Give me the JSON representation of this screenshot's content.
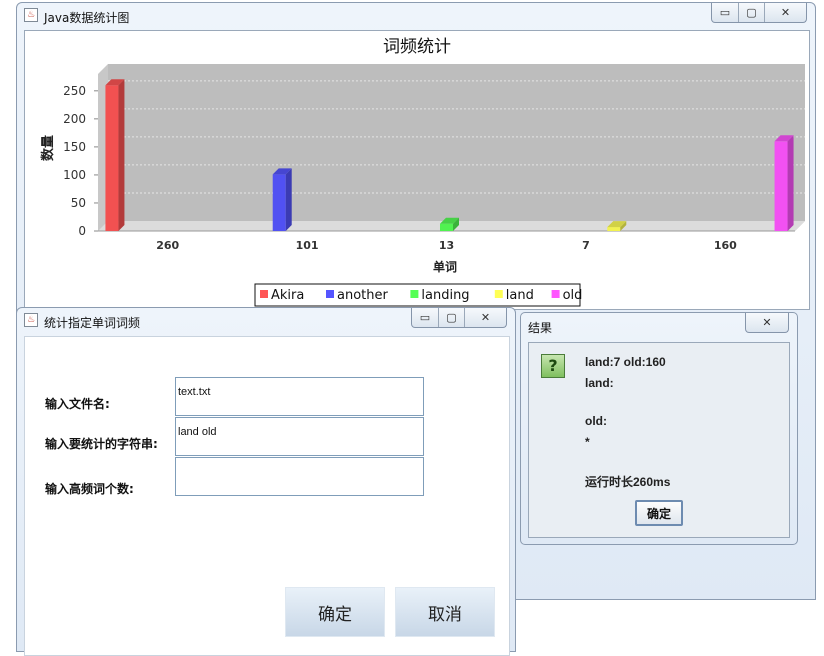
{
  "main_window": {
    "title": "Java数据统计图",
    "controls": {
      "minimize": "▭",
      "maximize": "▢",
      "close": "✕"
    }
  },
  "chart_data": {
    "type": "bar",
    "title": "词频统计",
    "xlabel": "单词",
    "ylabel": "数量",
    "ylim": [
      0,
      280
    ],
    "yticks": [
      0,
      50,
      100,
      150,
      200,
      250
    ],
    "categories": [
      "260",
      "101",
      "13",
      "7",
      "160"
    ],
    "series": [
      {
        "name": "Akira",
        "values": [
          260,
          0,
          0,
          0,
          0
        ],
        "color": "#ff5555"
      },
      {
        "name": "another",
        "values": [
          0,
          101,
          0,
          0,
          0
        ],
        "color": "#5555ff"
      },
      {
        "name": "landing",
        "values": [
          0,
          0,
          13,
          0,
          0
        ],
        "color": "#55ff55"
      },
      {
        "name": "land",
        "values": [
          0,
          0,
          0,
          7,
          0
        ],
        "color": "#ffff55"
      },
      {
        "name": "old",
        "values": [
          0,
          0,
          0,
          0,
          160
        ],
        "color": "#ff55ff"
      }
    ],
    "grid": true,
    "legend": "bottom"
  },
  "form_window": {
    "title": "统计指定单词词频",
    "controls": {
      "minimize": "▭",
      "maximize": "▢",
      "close": "✕"
    },
    "file_label": "输入文件名:",
    "file_value": "text.txt",
    "words_label": "输入要统计的字符串:",
    "words_value": "land old",
    "topn_label": "输入高频词个数:",
    "topn_value": "",
    "ok_label": "确定",
    "cancel_label": "取消"
  },
  "result_dialog": {
    "title": "结果",
    "close": "✕",
    "icon": "question-icon",
    "icon_glyph": "?",
    "line1": "land:7   old:160",
    "line2": "land:",
    "line3": "old:",
    "line4": "*",
    "line5": "运行时长260ms",
    "ok_label": "确定"
  }
}
